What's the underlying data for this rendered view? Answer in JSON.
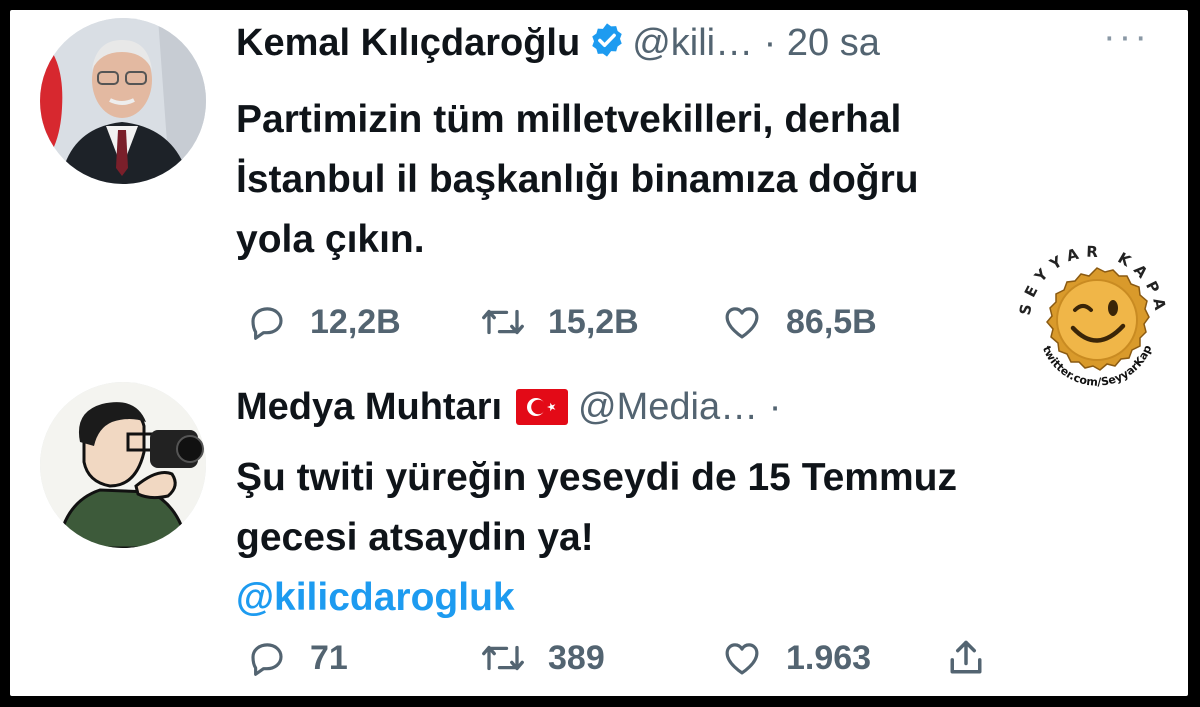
{
  "tweet1": {
    "name": "Kemal Kılıçdaroğlu",
    "handle": "@kili…",
    "separator": "·",
    "time": "20 sa",
    "more": "···",
    "lines": [
      "Partimizin tüm milletvekilleri, derhal",
      "İstanbul il başkanlığı binamıza doğru",
      "yola çıkın."
    ],
    "replies": "12,2B",
    "retweets": "15,2B",
    "likes": "86,5B"
  },
  "tweet2": {
    "name": "Medya Muhtarı",
    "handle": "@Media…",
    "separator": "·",
    "lines": [
      "Şu twiti yüreğin yeseydi de 15 Temmuz",
      "gecesi atsaydin ya!"
    ],
    "mention": "@kilicdarogluk",
    "replies": "71",
    "retweets": "389",
    "likes": "1.963"
  },
  "watermark": {
    "brand": "SEYYAR KAPAKÇI",
    "url": "twitter.com/SeyyarKapakci"
  },
  "colors": {
    "link": "#1d9bf0",
    "muted": "#536471",
    "verified": "#1d9bf0",
    "flag": "#e30a17"
  },
  "icons": [
    "verified-badge-icon",
    "turkey-flag-icon",
    "more-icon",
    "reply-icon",
    "retweet-icon",
    "like-icon",
    "share-icon"
  ]
}
